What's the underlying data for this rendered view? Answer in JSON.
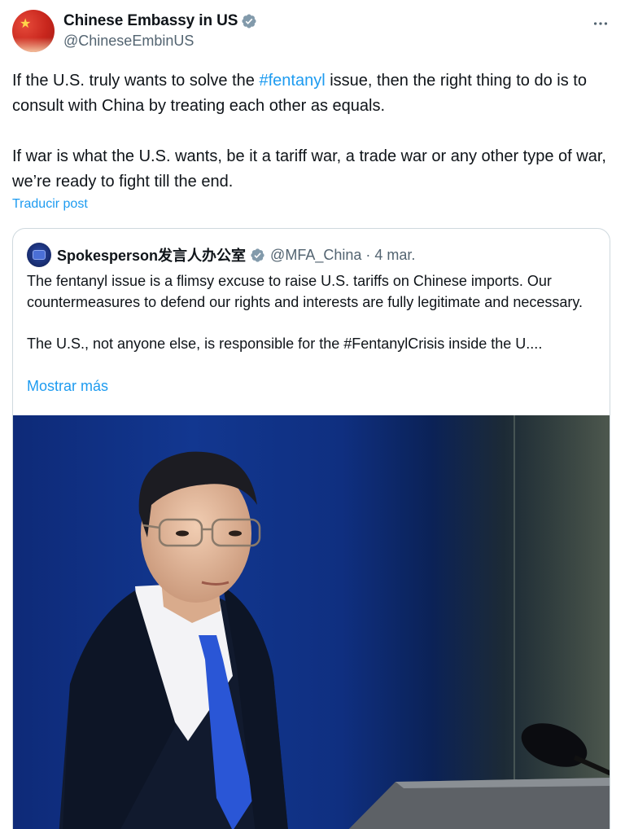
{
  "author": {
    "display_name": "Chinese Embassy in US",
    "handle": "@ChineseEmbinUS",
    "verified_icon": "verified-badge-icon"
  },
  "more_icon": "more-options-icon",
  "tweet": {
    "line1_before": "If the U.S. truly wants to solve the ",
    "line1_hashtag": "#fentanyl",
    "line1_after": " issue, then the right thing to do is to consult with China by treating each other as equals.",
    "paragraph2": "If war is what the U.S. wants, be it a tariff war, a trade war or any other type of war, we’re ready to fight till the end.",
    "translate_label": "Traducir post"
  },
  "quote": {
    "display_name": "Spokesperson发言人办公室",
    "handle_date": "@MFA_China · 4 mar.",
    "paragraph1": "The fentanyl issue is a flimsy excuse to raise U.S. tariffs on Chinese imports. Our countermeasures to defend our rights and interests are fully legitimate and necessary.",
    "paragraph2": "The U.S., not anyone else, is responsible for the #FentanylCrisis inside the U....",
    "show_more_label": "Mostrar más"
  },
  "colors": {
    "link": "#1d9bf0",
    "secondary_text": "#536471",
    "border": "#cfd9de"
  }
}
